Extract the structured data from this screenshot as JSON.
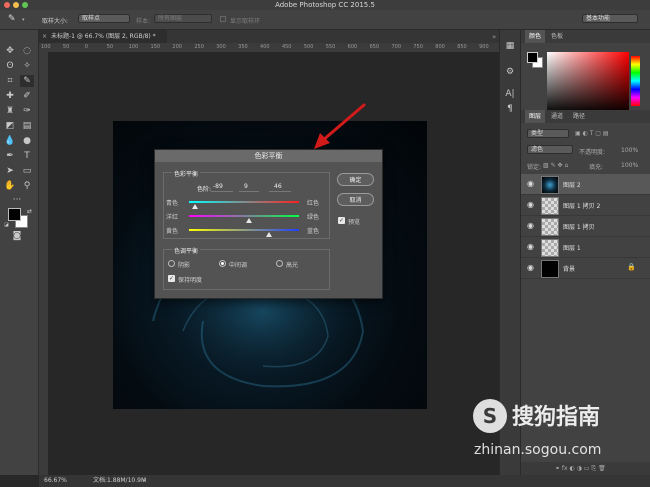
{
  "app": {
    "title": "Adobe Photoshop CC 2015.5"
  },
  "options_bar": {
    "sample_size_label": "取样大小:",
    "sample_size_value": "取样点",
    "sample_label": "样本:",
    "sample_value": "所有图层",
    "show_ring_label": "显示取样环",
    "workspace_value": "基本功能"
  },
  "document": {
    "tab_label": "未标题-1 @ 66.7% (图层 2, RGB/8) *",
    "ruler_ticks": [
      "100",
      "50",
      "0",
      "50",
      "100",
      "150",
      "200",
      "250",
      "300",
      "350",
      "400",
      "450",
      "500",
      "550",
      "600",
      "650",
      "700",
      "750",
      "800",
      "850",
      "900"
    ]
  },
  "status": {
    "zoom": "66.67%",
    "doc_info": "文档:1.88M/10.9M"
  },
  "color_panel": {
    "tabs": [
      "颜色",
      "色板"
    ],
    "fg_color": "#000000",
    "bg_color": "#ffffff",
    "field_hue": "#ff0000"
  },
  "layers_panel": {
    "tabs": [
      "图层",
      "通道",
      "路径"
    ],
    "filter_label": "类型",
    "blend_mode": "滤色",
    "opacity_label": "不透明度:",
    "opacity_value": "100%",
    "lock_label": "锁定:",
    "fill_label": "填充:",
    "fill_value": "100%",
    "layers": [
      {
        "name": "图层 2",
        "selected": true
      },
      {
        "name": "图层 1 拷贝 2",
        "selected": false
      },
      {
        "name": "图层 1 拷贝",
        "selected": false
      },
      {
        "name": "图层 1",
        "selected": false
      },
      {
        "name": "背景",
        "selected": false,
        "locked": true
      }
    ]
  },
  "dialog": {
    "title": "色彩平衡",
    "balance_group": "色彩平衡",
    "levels_label": "色阶:",
    "levels": [
      -89,
      9,
      46
    ],
    "sliders": [
      {
        "left": "青色",
        "right": "红色",
        "value": -89
      },
      {
        "left": "洋红",
        "right": "绿色",
        "value": 9
      },
      {
        "left": "黄色",
        "right": "蓝色",
        "value": 46
      }
    ],
    "tone_group": "色调平衡",
    "tones": [
      "阴影",
      "中间调",
      "高光"
    ],
    "selected_tone": "中间调",
    "preserve_luminosity": "保持明度",
    "ok": "确定",
    "cancel": "取消",
    "preview": "预览"
  },
  "watermark": {
    "brand": "搜狗指南",
    "url": "zhinan.sogou.com"
  }
}
